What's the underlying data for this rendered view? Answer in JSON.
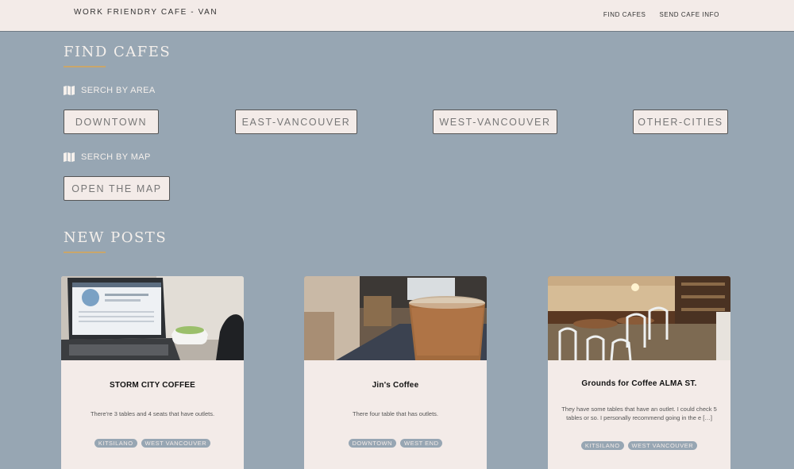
{
  "header": {
    "brand": "WORK FRIENDRY CAFE - VAN",
    "nav": [
      "FIND CAFES",
      "SEND CAFE INFO"
    ]
  },
  "find": {
    "title": "FIND CAFES",
    "area_label": "SERCH BY AREA",
    "areas": [
      "DOWNTOWN",
      "EAST-VANCOUVER",
      "WEST-VANCOUVER",
      "OTHER-CITIES"
    ],
    "map_label": "SERCH BY MAP",
    "map_button": "OPEN THE MAP"
  },
  "posts": {
    "title": "NEW POSTS",
    "cards": [
      {
        "title": "STORM CITY COFFEE",
        "desc": "There're 3 tables and 4 seats that have outlets.",
        "tags": [
          "KITSILANO",
          "WEST VANCOUVER"
        ]
      },
      {
        "title": "Jin's Coffee",
        "desc": "There four table that has outlets.",
        "tags": [
          "DOWNTOWN",
          "WEST END"
        ]
      },
      {
        "title": "Grounds for Coffee ALMA ST.",
        "desc": "They have some tables that have an outlet. I could check 5 tables or so. I personally recommend going in the e […]",
        "tags": [
          "KITSILANO",
          "WEST VANCOUVER"
        ]
      }
    ]
  },
  "colors": {
    "background": "#97a6b3",
    "surface": "#f3ebe8",
    "accent": "#c9a66b"
  }
}
